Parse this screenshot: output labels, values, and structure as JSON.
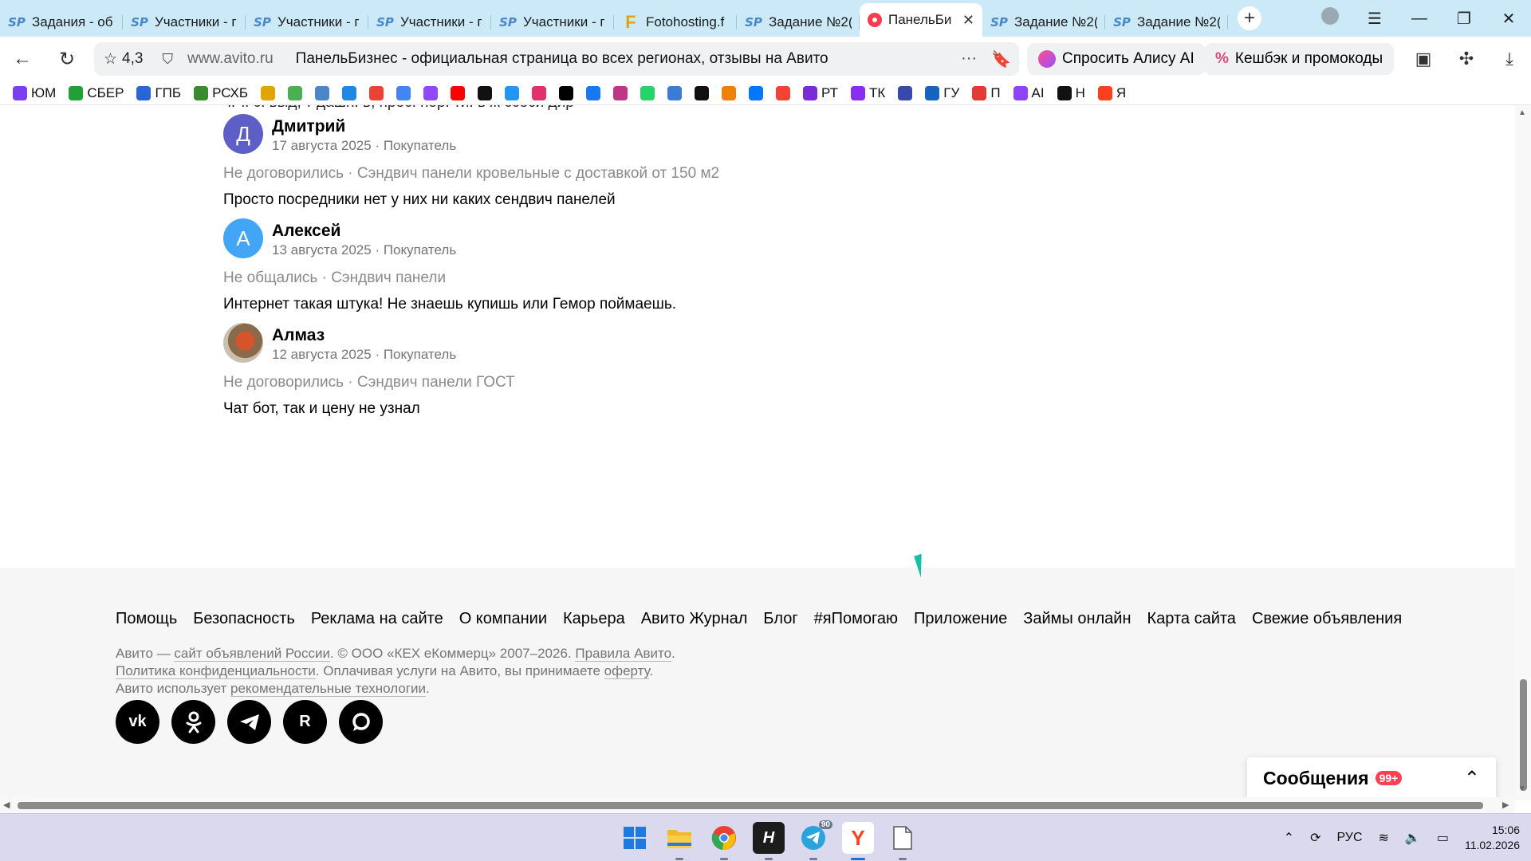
{
  "browser": {
    "tabs": [
      {
        "icon": "sp",
        "label": "Задания - об",
        "active": false
      },
      {
        "icon": "sp",
        "label": "Участники - г",
        "active": false
      },
      {
        "icon": "sp",
        "label": "Участники - г",
        "active": false
      },
      {
        "icon": "sp",
        "label": "Участники - г",
        "active": false
      },
      {
        "icon": "sp",
        "label": "Участники - г",
        "active": false
      },
      {
        "icon": "f",
        "label": "Fotohosting.f",
        "active": false
      },
      {
        "icon": "sp",
        "label": "Задание №2(",
        "active": false
      },
      {
        "icon": "avito",
        "label": "ПанельБи",
        "active": true
      },
      {
        "icon": "sp",
        "label": "Задание №2(",
        "active": false
      },
      {
        "icon": "sp",
        "label": "Задание №2(",
        "active": false
      }
    ],
    "address": {
      "rating": "4,3",
      "domain": "www.avito.ru",
      "page_title": "ПанельБизнес - официальная страница во всех регионах, отзывы на Авито"
    },
    "alice_label": "Спросить Алису AI",
    "cashback_label": "Кешбэк и промокоды",
    "bookmarks": [
      {
        "label": "ЮМ",
        "color": "#7b3ff2"
      },
      {
        "label": "СБЕР",
        "color": "#21a038"
      },
      {
        "label": "ГПБ",
        "color": "#2b64d6"
      },
      {
        "label": "РСХБ",
        "color": "#3a8a2e"
      },
      {
        "label": "",
        "color": "#e2a400"
      },
      {
        "label": "",
        "color": "#4caf50"
      },
      {
        "label": "",
        "color": "#4a86c8"
      },
      {
        "label": "",
        "color": "#1e88e5"
      },
      {
        "label": "",
        "color": "#ea4335"
      },
      {
        "label": "",
        "color": "#4285f4"
      },
      {
        "label": "",
        "color": "#9146ff"
      },
      {
        "label": "",
        "color": "#ff0000"
      },
      {
        "label": "",
        "color": "#111111"
      },
      {
        "label": "",
        "color": "#2196f3"
      },
      {
        "label": "",
        "color": "#e1306c"
      },
      {
        "label": "",
        "color": "#000000"
      },
      {
        "label": "",
        "color": "#1877f2"
      },
      {
        "label": "",
        "color": "#c13584"
      },
      {
        "label": "",
        "color": "#25d366"
      },
      {
        "label": "",
        "color": "#3a7bd5"
      },
      {
        "label": "",
        "color": "#111111"
      },
      {
        "label": "",
        "color": "#ee8208"
      },
      {
        "label": "",
        "color": "#0077ff"
      },
      {
        "label": "",
        "color": "#f44336"
      },
      {
        "label": "РТ",
        "color": "#7a2bd6"
      },
      {
        "label": "ТК",
        "color": "#8b2df2"
      },
      {
        "label": "",
        "color": "#3949ab"
      },
      {
        "label": "ГУ",
        "color": "#1565c0"
      },
      {
        "label": "П",
        "color": "#e53935"
      },
      {
        "label": "AI",
        "color": "#8e44ff"
      },
      {
        "label": "Н",
        "color": "#111111"
      },
      {
        "label": "Я",
        "color": "#fc3f1d"
      }
    ]
  },
  "reviews": {
    "cut_text": "ч. т. с. выд, т дашн. в, прос. пор. ти. в ж ссоси дир",
    "items": [
      {
        "initial": "Д",
        "avatar_style": "purple",
        "name": "Дмитрий",
        "meta": "17 августа 2025 · Покупатель",
        "deal": "Не договорились · Сэндвич панели кровельные с доставкой от 150 м2",
        "text": "Просто посредники нет у них ни каких сендвич панелей"
      },
      {
        "initial": "А",
        "avatar_style": "blue",
        "name": "Алексей",
        "meta": "13 августа 2025 · Покупатель",
        "deal": "Не общались · Сэндвич панели",
        "text": "Интернет такая штука! Не знаешь купишь или Гемор поймаешь."
      },
      {
        "initial": "",
        "avatar_style": "photo",
        "name": "Алмаз",
        "meta": "12 августа 2025 · Покупатель",
        "deal": "Не договорились · Сэндвич панели ГОСТ",
        "text": "Чат бот, так и цену не узнал"
      }
    ]
  },
  "footer": {
    "links": [
      "Помощь",
      "Безопасность",
      "Реклама на сайте",
      "О компании",
      "Карьера",
      "Авито Журнал",
      "Блог",
      "#яПомогаю",
      "Приложение",
      "Займы онлайн",
      "Карта сайта",
      "Свежие объявления"
    ],
    "legal": {
      "l1a": "Авито — ",
      "l1b": "сайт объявлений России",
      "l1c": ". © ООО «КЕХ еКоммерц» 2007–2026. ",
      "l1d": "Правила Авито",
      "l1e": ".",
      "l2a": "Политика конфиденциальности",
      "l2b": ". Оплачивая услуги на Авито, вы принимаете ",
      "l2c": "оферту",
      "l2d": ".",
      "l3a": "Авито использует ",
      "l3b": "рекомендательные технологии",
      "l3c": "."
    },
    "socials": [
      "vk-icon",
      "odnoklassniki-icon",
      "telegram-icon",
      "rutube-icon",
      "max-messenger-icon"
    ]
  },
  "messages": {
    "title": "Сообщения",
    "badge": "99+"
  },
  "taskbar": {
    "telegram_badge": "90",
    "language": "РУС",
    "time": "15:06",
    "date": "11.02.2026"
  }
}
